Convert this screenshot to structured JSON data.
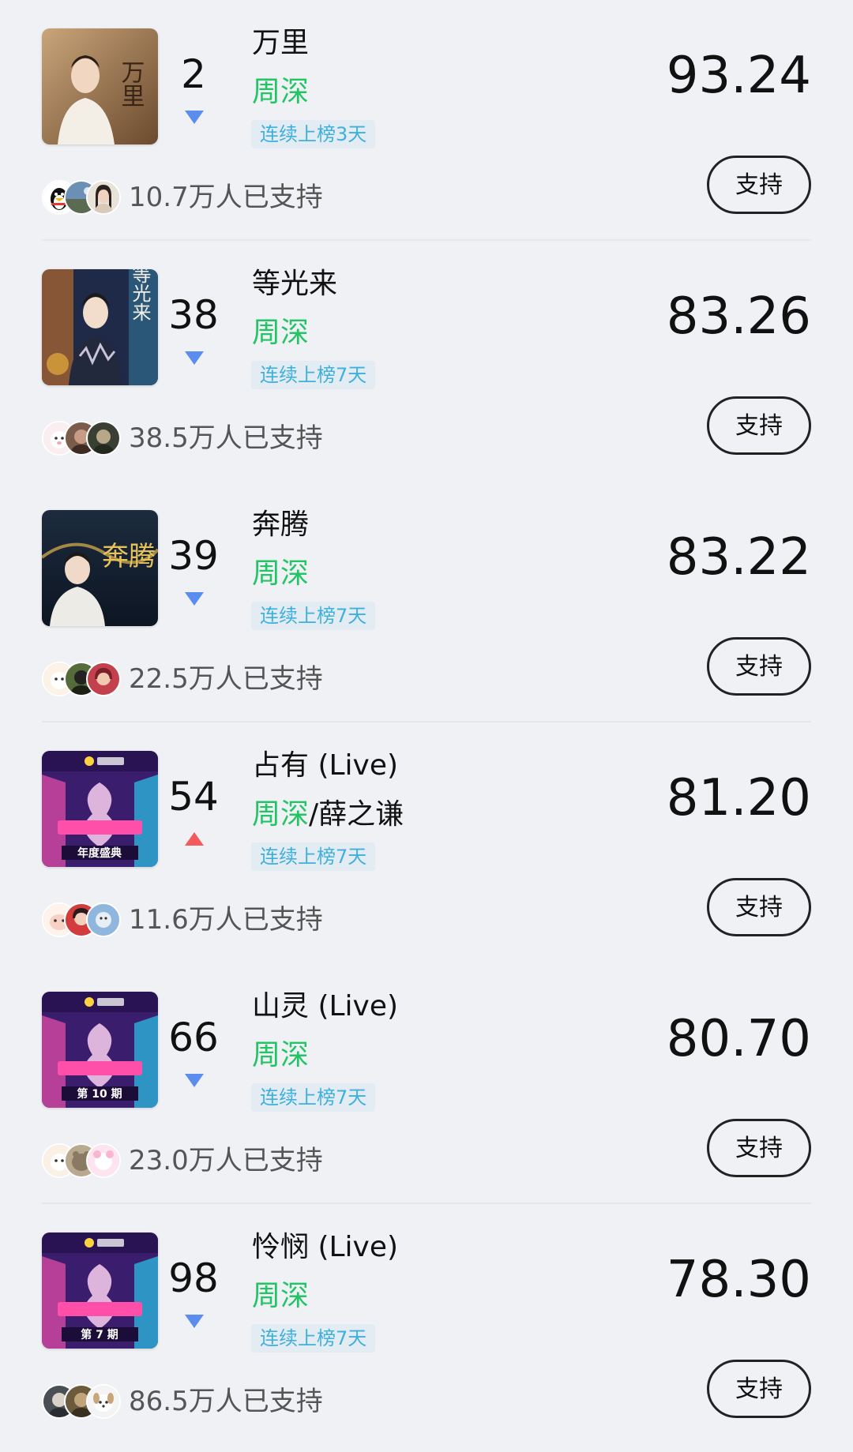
{
  "colors": {
    "artist_highlight": "#22c466",
    "trend_down": "#5b8def",
    "trend_up": "#f55a5a",
    "badge_text": "#3fb0de",
    "badge_bg": "#e3ecf2"
  },
  "songs": [
    {
      "title": "万里",
      "artist_primary": "周深",
      "artist_rest": "",
      "rank": "2",
      "trend": "down",
      "trend_icon": "triangle-down-icon",
      "streak": "连续上榜3天",
      "score": "93.24",
      "supporters": "10.7万人已支持",
      "support_label": "支持",
      "cover_text": "万里"
    },
    {
      "title": "等光来",
      "artist_primary": "周深",
      "artist_rest": "",
      "rank": "38",
      "trend": "down",
      "trend_icon": "triangle-down-icon",
      "streak": "连续上榜7天",
      "score": "83.26",
      "supporters": "38.5万人已支持",
      "support_label": "支持",
      "cover_text": "等光来"
    },
    {
      "title": "奔腾",
      "artist_primary": "周深",
      "artist_rest": "",
      "rank": "39",
      "trend": "down",
      "trend_icon": "triangle-down-icon",
      "streak": "连续上榜7天",
      "score": "83.22",
      "supporters": "22.5万人已支持",
      "support_label": "支持",
      "cover_text": "奔腾"
    },
    {
      "title": "占有 (Live)",
      "artist_primary": "周深",
      "artist_rest": "/薛之谦",
      "rank": "54",
      "trend": "up",
      "trend_icon": "triangle-up-icon",
      "streak": "连续上榜7天",
      "score": "81.20",
      "supporters": "11.6万人已支持",
      "support_label": "支持",
      "cover_text": "年度盛典"
    },
    {
      "title": "山灵 (Live)",
      "artist_primary": "周深",
      "artist_rest": "",
      "rank": "66",
      "trend": "down",
      "trend_icon": "triangle-down-icon",
      "streak": "连续上榜7天",
      "score": "80.70",
      "supporters": "23.0万人已支持",
      "support_label": "支持",
      "cover_text": "第 10 期"
    },
    {
      "title": "怜悯 (Live)",
      "artist_primary": "周深",
      "artist_rest": "",
      "rank": "98",
      "trend": "down",
      "trend_icon": "triangle-down-icon",
      "streak": "连续上榜7天",
      "score": "78.30",
      "supporters": "86.5万人已支持",
      "support_label": "支持",
      "cover_text": "第 7 期"
    }
  ]
}
